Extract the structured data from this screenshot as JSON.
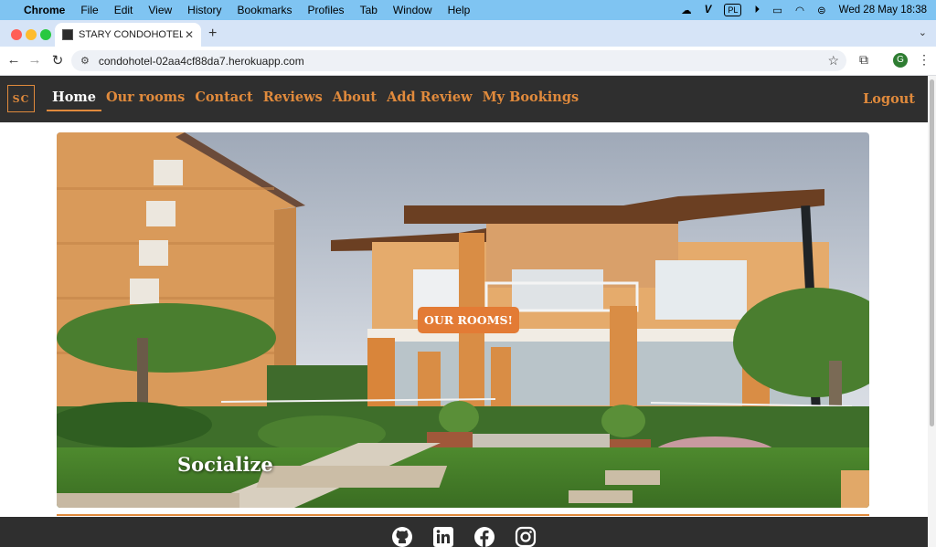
{
  "menubar": {
    "app": "Chrome",
    "items": [
      "File",
      "Edit",
      "View",
      "History",
      "Bookmarks",
      "Profiles",
      "Tab",
      "Window",
      "Help"
    ],
    "input_source": "PL",
    "datetime": "Wed 28 May  18:38"
  },
  "browser": {
    "tab_title": "STARY CONDOHOTEL -Home",
    "url": "condohotel-02aa4cf88da7.herokuapp.com",
    "profile_initial": "G"
  },
  "site": {
    "logo": "SC",
    "nav": [
      "Home",
      "Our rooms",
      "Contact",
      "Reviews",
      "About",
      "Add Review",
      "My Bookings"
    ],
    "logout": "Logout",
    "hero": {
      "button": "OUR ROOMS!",
      "caption": "Socialize"
    },
    "footer": {
      "icons": [
        "github-icon",
        "linkedin-icon",
        "facebook-icon",
        "instagram-icon"
      ]
    }
  },
  "colors": {
    "accent": "#e08a3c",
    "nav_bg": "#2f2f2f",
    "button": "#e37b35"
  }
}
